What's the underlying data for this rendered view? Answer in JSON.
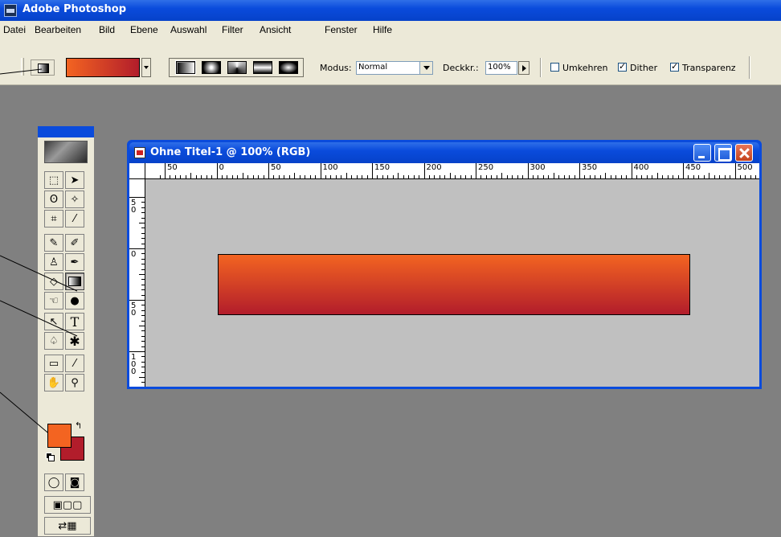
{
  "app": {
    "title": "Adobe Photoshop"
  },
  "menu": [
    "Datei",
    "Bearbeiten",
    "Bild",
    "Ebene",
    "Auswahl",
    "Filter",
    "Ansicht",
    "Fenster",
    "Hilfe"
  ],
  "options": {
    "gradient_start": "#f36421",
    "gradient_end": "#b21d2b",
    "gradient_types": [
      "linear-gradient-icon",
      "radial-gradient-icon",
      "angle-gradient-icon",
      "reflected-gradient-icon",
      "diamond-gradient-icon"
    ],
    "modus_label": "Modus:",
    "modus_value": "Normal",
    "opacity_label": "Deckkr.:",
    "opacity_value": "100%",
    "checkboxes": [
      {
        "label": "Umkehren",
        "checked": false
      },
      {
        "label": "Dither",
        "checked": true
      },
      {
        "label": "Transparenz",
        "checked": true
      }
    ]
  },
  "document": {
    "title": "Ohne Titel-1 @ 100% (RGB)",
    "ruler_h_labels": [
      "50",
      "0",
      "50",
      "100",
      "150",
      "200",
      "250",
      "300",
      "350",
      "400",
      "450",
      "500"
    ],
    "ruler_v_labels": [
      "50",
      "0",
      "50",
      "100"
    ]
  },
  "colors": {
    "foreground": "#f36421",
    "background": "#b21d2b",
    "accent": "#0a4bdc"
  }
}
